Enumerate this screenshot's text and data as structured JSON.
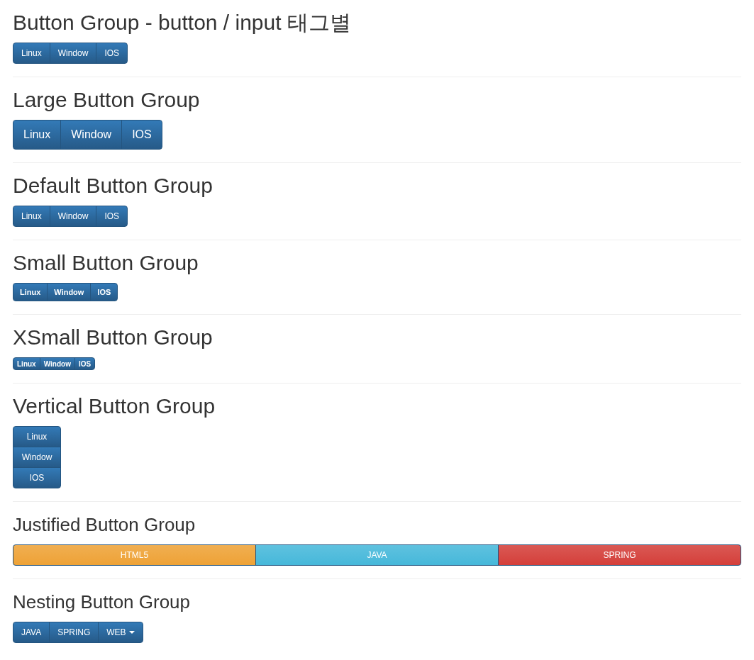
{
  "sections": [
    {
      "title": "Button Group - button / input 태그별",
      "kind": "default",
      "buttons": [
        {
          "label": "Linux"
        },
        {
          "label": "Window"
        },
        {
          "label": "IOS"
        }
      ]
    },
    {
      "title": "Large Button Group",
      "kind": "large",
      "buttons": [
        {
          "label": "Linux"
        },
        {
          "label": "Window"
        },
        {
          "label": "IOS"
        }
      ]
    },
    {
      "title": "Default Button Group",
      "kind": "default",
      "buttons": [
        {
          "label": "Linux"
        },
        {
          "label": "Window"
        },
        {
          "label": "IOS"
        }
      ]
    },
    {
      "title": "Small Button Group",
      "kind": "small",
      "buttons": [
        {
          "label": "Linux"
        },
        {
          "label": "Window"
        },
        {
          "label": "IOS"
        }
      ]
    },
    {
      "title": "XSmall Button Group",
      "kind": "xsmall",
      "buttons": [
        {
          "label": "Linux"
        },
        {
          "label": "Window"
        },
        {
          "label": "IOS"
        }
      ]
    },
    {
      "title": "Vertical Button Group",
      "kind": "vertical",
      "buttons": [
        {
          "label": "Linux"
        },
        {
          "label": "Window"
        },
        {
          "label": "IOS"
        }
      ]
    },
    {
      "title": "Justified Button Group",
      "kind": "justified",
      "buttons": [
        {
          "label": "HTML5",
          "color": "#eea236"
        },
        {
          "label": "JAVA",
          "color": "#46b8da"
        },
        {
          "label": "SPRING",
          "color": "#d43f3a"
        }
      ]
    },
    {
      "title": "Nesting Button Group",
      "kind": "nesting",
      "buttons": [
        {
          "label": "JAVA",
          "dropdown": false
        },
        {
          "label": "SPRING",
          "dropdown": false
        },
        {
          "label": "WEB",
          "dropdown": true
        }
      ]
    }
  ]
}
